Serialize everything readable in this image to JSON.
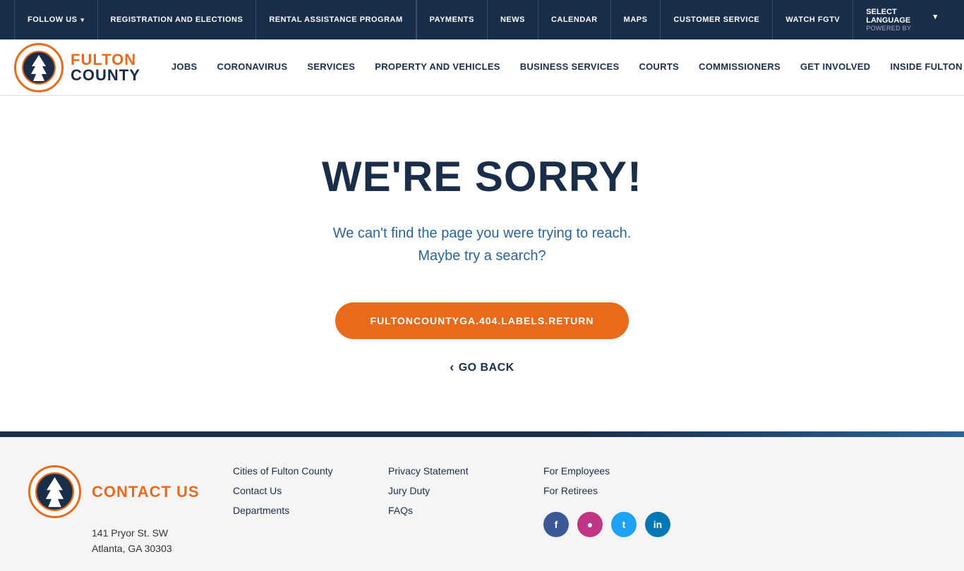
{
  "utility_bar": {
    "follow_us": "FOLLOW US",
    "registration": "REGISTRATION AND ELECTIONS",
    "rental": "RENTAL ASSISTANCE PROGRAM",
    "payments": "PAYMENTS",
    "news": "NEWS",
    "calendar": "CALENDAR",
    "maps": "MAPS",
    "customer_service": "CUSTOMER SERVICE",
    "watch_fgtv": "WATCH FGTV",
    "select_language": "SELECT LANGUAGE",
    "powered_by": "POWERED BY"
  },
  "nav": {
    "logo_fulton": "FULTON",
    "logo_county": "COUNTY",
    "jobs": "JOBS",
    "coronavirus": "CORONAVIRUS",
    "services": "SERVICES",
    "property_vehicles": "PROPERTY AND VEHICLES",
    "business_services": "BUSINESS SERVICES",
    "courts": "COURTS",
    "commissioners": "COMMISSIONERS",
    "get_involved": "GET INVOLVED",
    "inside_fulton": "INSIDE FULTON COUNTY"
  },
  "main": {
    "error_title": "WE'RE SORRY!",
    "error_line1": "We can't find the page you were trying to reach.",
    "error_line2": "Maybe try a search?",
    "return_btn": "FULTONCOUNTYGA.404.LABELS.RETURN",
    "go_back": "GO BACK"
  },
  "footer": {
    "contact_us_title": "CONTACT US",
    "address_line1": "141 Pryor St. SW",
    "address_line2": "Atlanta, GA 30303",
    "col1": {
      "link1": "Cities of Fulton County",
      "link2": "Contact Us",
      "link3": "Departments"
    },
    "col2": {
      "link1": "Privacy Statement",
      "link2": "Jury Duty",
      "link3": "FAQs"
    },
    "col3": {
      "link1": "For Employees",
      "link2": "For Retirees"
    }
  }
}
